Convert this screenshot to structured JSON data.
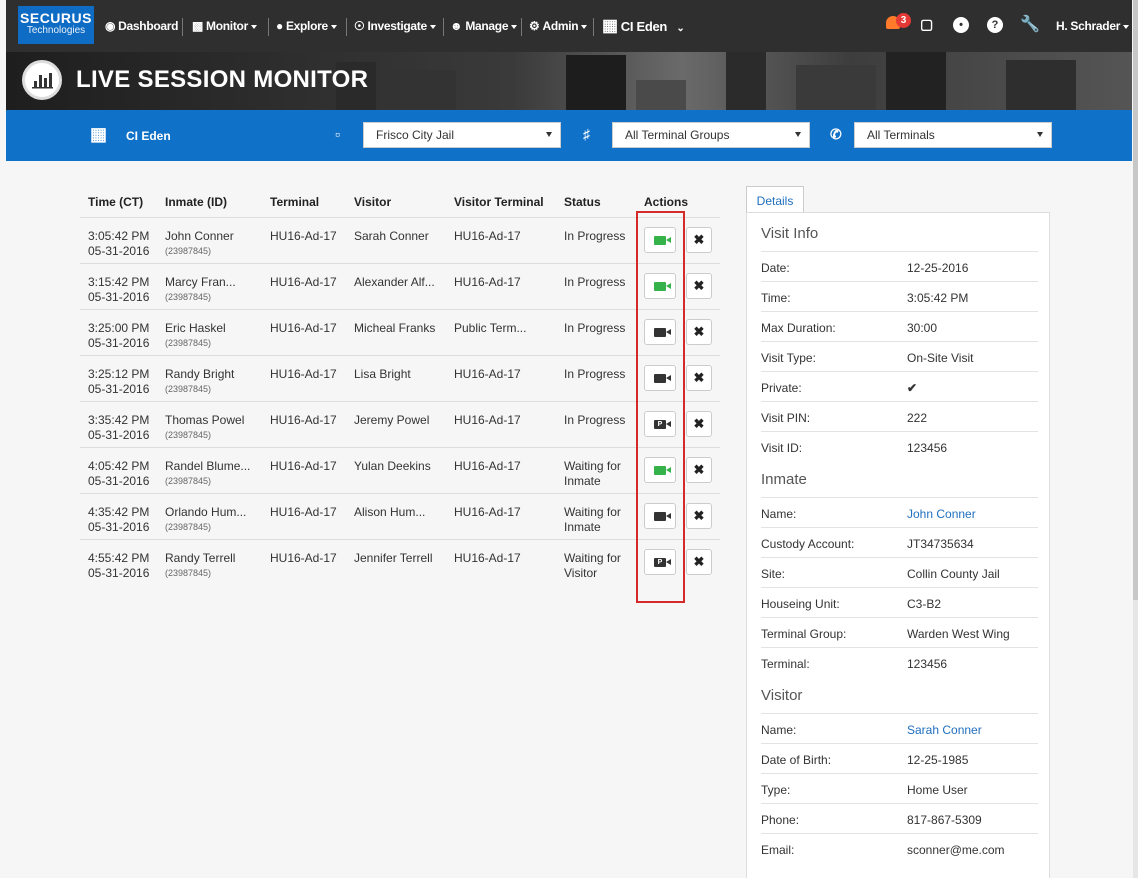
{
  "brand": {
    "line1": "SECURUS",
    "line2": "Technologies"
  },
  "nav": {
    "dashboard": "Dashboard",
    "monitor": "Monitor",
    "explore": "Explore",
    "investigate": "Investigate",
    "manage": "Manage",
    "admin": "Admin",
    "facility": "CI Eden",
    "notifications": "3",
    "user": "H. Schrader"
  },
  "page_title": "LIVE SESSION MONITOR",
  "filters": {
    "site": "CI Eden",
    "facility": "Frisco City Jail",
    "terminal_group": "All Terminal Groups",
    "terminal": "All Terminals"
  },
  "table": {
    "headers": [
      "Time (CT)",
      "Inmate (ID)",
      "Terminal",
      "Visitor",
      "Visitor Terminal",
      "Status",
      "Actions"
    ],
    "rows": [
      {
        "time": "3:05:42 PM",
        "date": "05-31-2016",
        "inmate": "John Conner",
        "id": "(23987845)",
        "terminal": "HU16-Ad-17",
        "visitor": "Sarah Conner",
        "vterm": "HU16-Ad-17",
        "status": "In Progress",
        "status2": "",
        "cam": "green"
      },
      {
        "time": "3:15:42 PM",
        "date": "05-31-2016",
        "inmate": "Marcy Fran...",
        "id": "(23987845)",
        "terminal": "HU16-Ad-17",
        "visitor": "Alexander Alf...",
        "vterm": "HU16-Ad-17",
        "status": "In Progress",
        "status2": "",
        "cam": "green"
      },
      {
        "time": "3:25:00 PM",
        "date": "05-31-2016",
        "inmate": "Eric Haskel",
        "id": "(23987845)",
        "terminal": "HU16-Ad-17",
        "visitor": "Micheal Franks",
        "vterm": "Public Term...",
        "status": "In Progress",
        "status2": "",
        "cam": "dark"
      },
      {
        "time": "3:25:12 PM",
        "date": "05-31-2016",
        "inmate": "Randy Bright",
        "id": "(23987845)",
        "terminal": "HU16-Ad-17",
        "visitor": "Lisa Bright",
        "vterm": "HU16-Ad-17",
        "status": "In Progress",
        "status2": "",
        "cam": "dark"
      },
      {
        "time": "3:35:42 PM",
        "date": "05-31-2016",
        "inmate": "Thomas Powel",
        "id": "(23987845)",
        "terminal": "HU16-Ad-17",
        "visitor": "Jeremy Powel",
        "vterm": "HU16-Ad-17",
        "status": "In Progress",
        "status2": "",
        "cam": "private"
      },
      {
        "time": "4:05:42 PM",
        "date": "05-31-2016",
        "inmate": "Randel Blume...",
        "id": "(23987845)",
        "terminal": "HU16-Ad-17",
        "visitor": "Yulan Deekins",
        "vterm": "HU16-Ad-17",
        "status": "Waiting for",
        "status2": "Inmate",
        "cam": "green"
      },
      {
        "time": "4:35:42 PM",
        "date": "05-31-2016",
        "inmate": "Orlando Hum...",
        "id": "(23987845)",
        "terminal": "HU16-Ad-17",
        "visitor": "Alison Hum...",
        "vterm": "HU16-Ad-17",
        "status": "Waiting for",
        "status2": "Inmate",
        "cam": "dark"
      },
      {
        "time": "4:55:42 PM",
        "date": "05-31-2016",
        "inmate": "Randy Terrell",
        "id": "(23987845)",
        "terminal": "HU16-Ad-17",
        "visitor": "Jennifer Terrell",
        "vterm": "HU16-Ad-17",
        "status": "Waiting for",
        "status2": "Visitor",
        "cam": "private"
      }
    ]
  },
  "details": {
    "tab": "Details",
    "sections": [
      {
        "title": "Visit Info",
        "rows": [
          {
            "k": "Date:",
            "v": "12-25-2016"
          },
          {
            "k": "Time:",
            "v": "3:05:42 PM"
          },
          {
            "k": "Max Duration:",
            "v": "30:00"
          },
          {
            "k": "Visit Type:",
            "v": "On-Site Visit"
          },
          {
            "k": "Private:",
            "v": "✔"
          },
          {
            "k": "Visit PIN:",
            "v": "222"
          },
          {
            "k": "Visit ID:",
            "v": "123456"
          }
        ]
      },
      {
        "title": "Inmate",
        "rows": [
          {
            "k": "Name:",
            "v": "John Conner"
          },
          {
            "k": "Custody Account:",
            "v": "JT34735634"
          },
          {
            "k": "Site:",
            "v": "Collin County Jail"
          },
          {
            "k": "Houseing Unit:",
            "v": "C3-B2"
          },
          {
            "k": "Terminal Group:",
            "v": "Warden West Wing"
          },
          {
            "k": "Terminal:",
            "v": "123456"
          }
        ]
      },
      {
        "title": "Visitor",
        "rows": [
          {
            "k": "Name:",
            "v": "Sarah Conner"
          },
          {
            "k": "Date of Birth:",
            "v": "12-25-1985"
          },
          {
            "k": "Type:",
            "v": "Home User"
          },
          {
            "k": "Phone:",
            "v": "817-867-5309"
          },
          {
            "k": "Email:",
            "v": "sconner@me.com"
          }
        ]
      }
    ]
  },
  "colors": {
    "primary": "#0f71c8",
    "nav": "#2f2f2f",
    "green": "#35b34a",
    "highlight": "#d42a2a"
  }
}
